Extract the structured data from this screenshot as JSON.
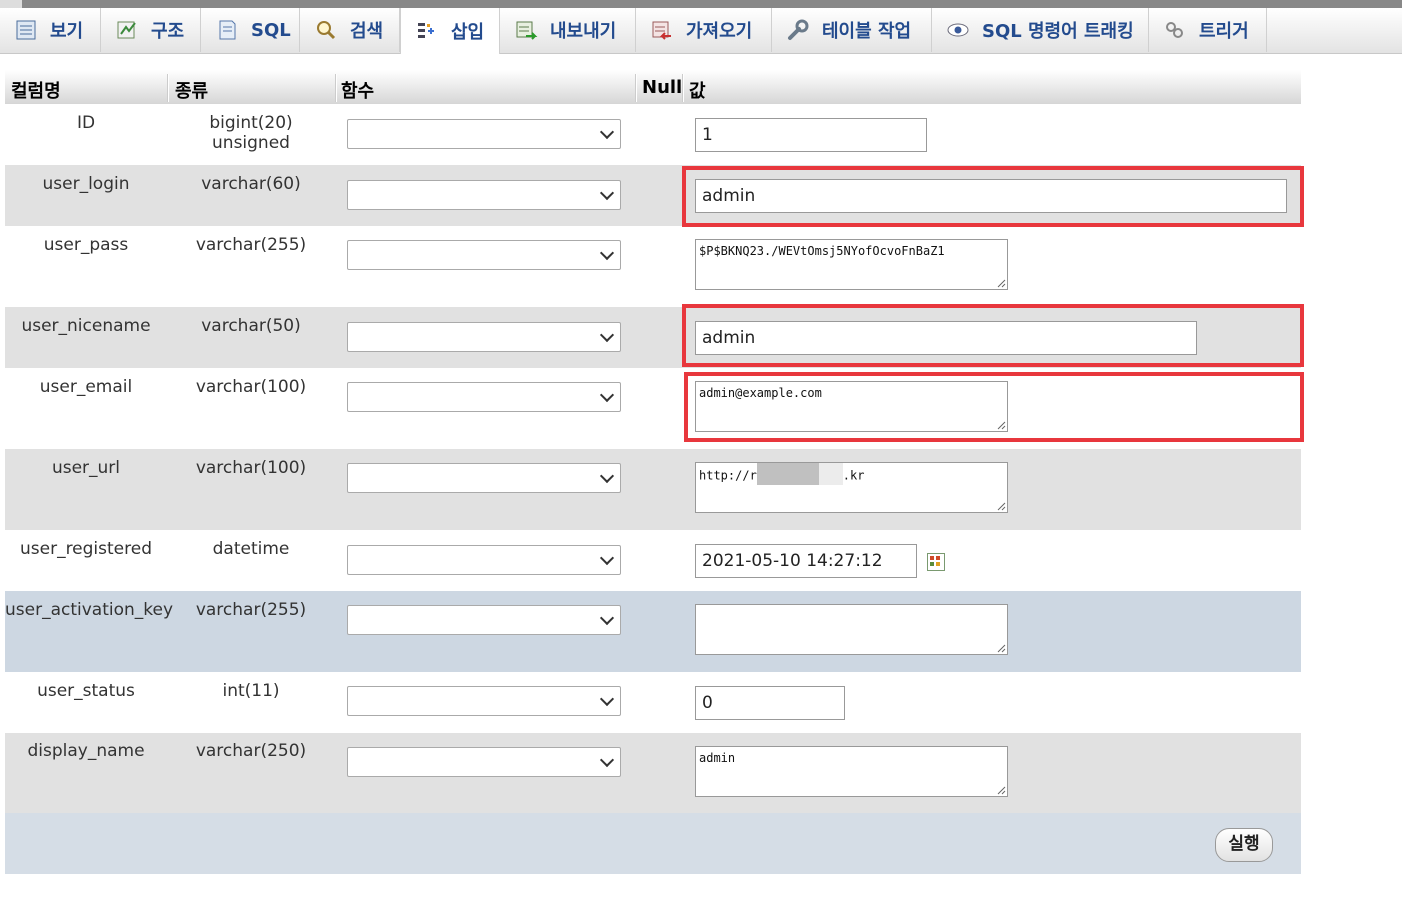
{
  "tabs": [
    {
      "label": "보기",
      "icon": "browse-icon"
    },
    {
      "label": "구조",
      "icon": "structure-icon"
    },
    {
      "label": "SQL",
      "icon": "sql-icon"
    },
    {
      "label": "검색",
      "icon": "search-icon"
    },
    {
      "label": "삽입",
      "icon": "insert-icon"
    },
    {
      "label": "내보내기",
      "icon": "export-icon"
    },
    {
      "label": "가져오기",
      "icon": "import-icon"
    },
    {
      "label": "테이블 작업",
      "icon": "wrench-icon"
    },
    {
      "label": "SQL 명령어 트래킹",
      "icon": "eye-icon"
    },
    {
      "label": "트리거",
      "icon": "trigger-icon"
    }
  ],
  "active_tab": "삽입",
  "headers": {
    "column": "컬럼명",
    "type": "종류",
    "function": "함수",
    "null": "Null",
    "value": "값"
  },
  "rows": [
    {
      "name": "ID",
      "type": "bigint(20) unsigned",
      "value": "1"
    },
    {
      "name": "user_login",
      "type": "varchar(60)",
      "value": "admin"
    },
    {
      "name": "user_pass",
      "type": "varchar(255)",
      "value": "$P$BKNQ23./WEVtOmsj5NYofOcvoFnBaZ1"
    },
    {
      "name": "user_nicename",
      "type": "varchar(50)",
      "value": "admin"
    },
    {
      "name": "user_email",
      "type": "varchar(100)",
      "value": "admin@example.com"
    },
    {
      "name": "user_url",
      "type": "varchar(100)",
      "value_prefix": "http://r",
      "value_suffix": ".kr"
    },
    {
      "name": "user_registered",
      "type": "datetime",
      "value": "2021-05-10 14:27:12"
    },
    {
      "name": "user_activation_key",
      "type": "varchar(255)",
      "value": ""
    },
    {
      "name": "user_status",
      "type": "int(11)",
      "value": "0"
    },
    {
      "name": "display_name",
      "type": "varchar(250)",
      "value": "admin"
    }
  ],
  "execute_label": "실행",
  "colors": {
    "highlight": "#e8373d",
    "tab_text": "#234b8e",
    "row_grey": "#e1e1e1",
    "row_blue": "#cdd7e2"
  }
}
